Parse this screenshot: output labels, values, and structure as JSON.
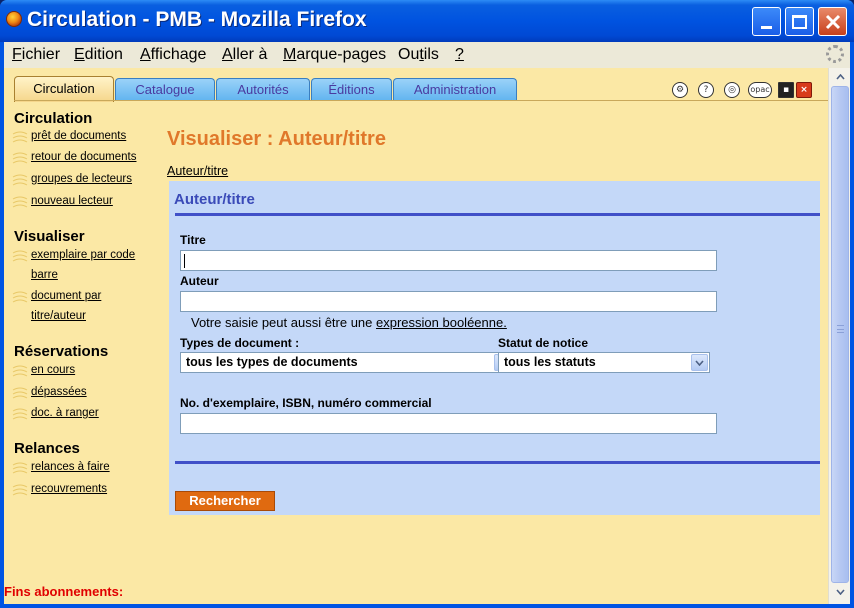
{
  "window": {
    "title": "Circulation - PMB - Mozilla Firefox"
  },
  "menubar": {
    "items": [
      {
        "prefix": "",
        "accel": "F",
        "rest": "ichier"
      },
      {
        "prefix": "",
        "accel": "E",
        "rest": "dition"
      },
      {
        "prefix": "",
        "accel": "A",
        "rest": "ffichage"
      },
      {
        "prefix": "",
        "accel": "A",
        "rest": "ller à"
      },
      {
        "prefix": "",
        "accel": "M",
        "rest": "arque-pages"
      },
      {
        "prefix": "Ou",
        "accel": "t",
        "rest": "ils"
      },
      {
        "prefix": "",
        "accel": "?",
        "rest": ""
      }
    ]
  },
  "tabs": [
    "Circulation",
    "Catalogue",
    "Autorités",
    "Éditions",
    "Administration"
  ],
  "active_tab": "Circulation",
  "toolbar_icons": [
    "gear-icon",
    "help-icon",
    "target-icon",
    "opac-icon",
    "save-icon",
    "close-icon"
  ],
  "toolbar": {
    "opac_label": "opac"
  },
  "sidebar": {
    "sections": [
      {
        "title": "Circulation",
        "links": [
          "prêt de documents",
          "retour de documents",
          "groupes de lecteurs",
          "nouveau lecteur"
        ]
      },
      {
        "title": "Visualiser",
        "links": [
          "exemplaire par code barre",
          "document par titre/auteur"
        ]
      },
      {
        "title": "Réservations",
        "links": [
          "en cours",
          "dépassées",
          "doc. à ranger"
        ]
      },
      {
        "title": "Relances",
        "links": [
          "relances à faire",
          "recouvrements"
        ]
      }
    ],
    "visualiser_wrapped": [
      "exemplaire par code",
      "barre",
      "document par",
      "titre/auteur"
    ],
    "footer": "Fins abonnements:"
  },
  "main": {
    "title": "Visualiser : Auteur/titre",
    "breadcrumb": "Auteur/titre",
    "form": {
      "title": "Auteur/titre",
      "titre_label": "Titre",
      "titre_value": "",
      "auteur_label": "Auteur",
      "auteur_value": "",
      "hint_text": "Votre saisie peut aussi être une ",
      "hint_link": "expression booléenne.",
      "types_label": "Types de document :",
      "types_value": "tous les types de documents",
      "statut_label": "Statut de notice",
      "statut_value": "tous les statuts",
      "numero_label": "No. d'exemplaire, ISBN, numéro commercial",
      "numero_value": "",
      "search_button": "Rechercher"
    }
  },
  "colors": {
    "page_bg": "#fbe8a5",
    "title_orange": "#e0782a",
    "form_bg": "#c4d8f8",
    "form_rule": "#4050c8",
    "button_orange": "#e06a10",
    "footer_red": "#e00000"
  }
}
